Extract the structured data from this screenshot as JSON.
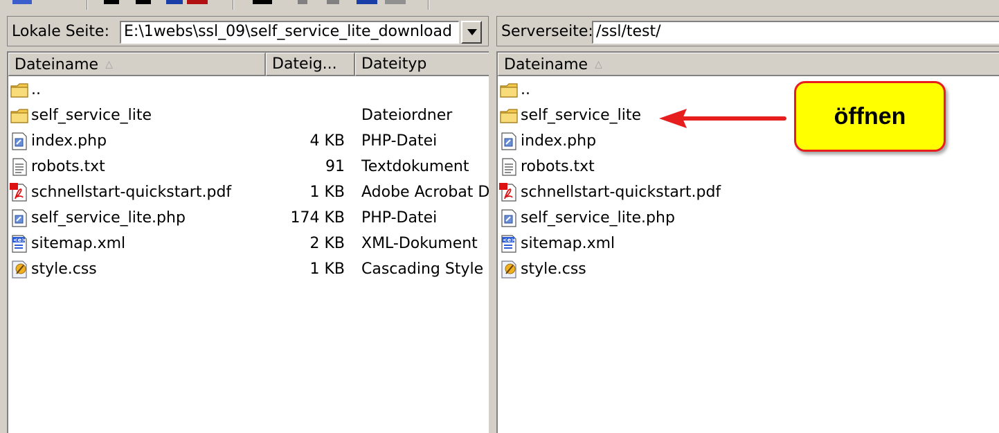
{
  "local": {
    "path_label": "Lokale Seite:",
    "path_value": "E:\\1webs\\ssl_09\\self_service_lite_download",
    "columns": [
      "Dateiname",
      "Dateig...",
      "Dateityp"
    ],
    "files": [
      {
        "name": "..",
        "size": "",
        "type": "",
        "icon": "folder-icon"
      },
      {
        "name": "self_service_lite",
        "size": "",
        "type": "Dateiordner",
        "icon": "folder-icon"
      },
      {
        "name": "index.php",
        "size": "4 KB",
        "type": "PHP-Datei",
        "icon": "php-file-icon"
      },
      {
        "name": "robots.txt",
        "size": "91",
        "type": "Textdokument",
        "icon": "text-file-icon"
      },
      {
        "name": "schnellstart-quickstart.pdf",
        "size": "1 KB",
        "type": "Adobe Acrobat D",
        "icon": "pdf-file-icon"
      },
      {
        "name": "self_service_lite.php",
        "size": "174 KB",
        "type": "PHP-Datei",
        "icon": "php-file-icon"
      },
      {
        "name": "sitemap.xml",
        "size": "2 KB",
        "type": "XML-Dokument",
        "icon": "xml-file-icon"
      },
      {
        "name": "style.css",
        "size": "1 KB",
        "type": "Cascading Style",
        "icon": "css-file-icon"
      }
    ]
  },
  "remote": {
    "path_label": "Serverseite:",
    "path_value": "/ssl/test/",
    "columns": [
      "Dateiname"
    ],
    "files": [
      {
        "name": "..",
        "icon": "folder-icon"
      },
      {
        "name": "self_service_lite",
        "icon": "folder-icon"
      },
      {
        "name": "index.php",
        "icon": "php-file-icon"
      },
      {
        "name": "robots.txt",
        "icon": "text-file-icon"
      },
      {
        "name": "schnellstart-quickstart.pdf",
        "icon": "pdf-file-icon"
      },
      {
        "name": "self_service_lite.php",
        "icon": "php-file-icon"
      },
      {
        "name": "sitemap.xml",
        "icon": "xml-file-icon"
      },
      {
        "name": "style.css",
        "icon": "css-file-icon"
      }
    ]
  },
  "annotation": {
    "callout_text": "öffnen"
  },
  "colors": {
    "window": "#d4d0c8",
    "callout_fill": "#ffff00",
    "callout_border": "#e61e1e",
    "arrow": "#e61e1e"
  }
}
